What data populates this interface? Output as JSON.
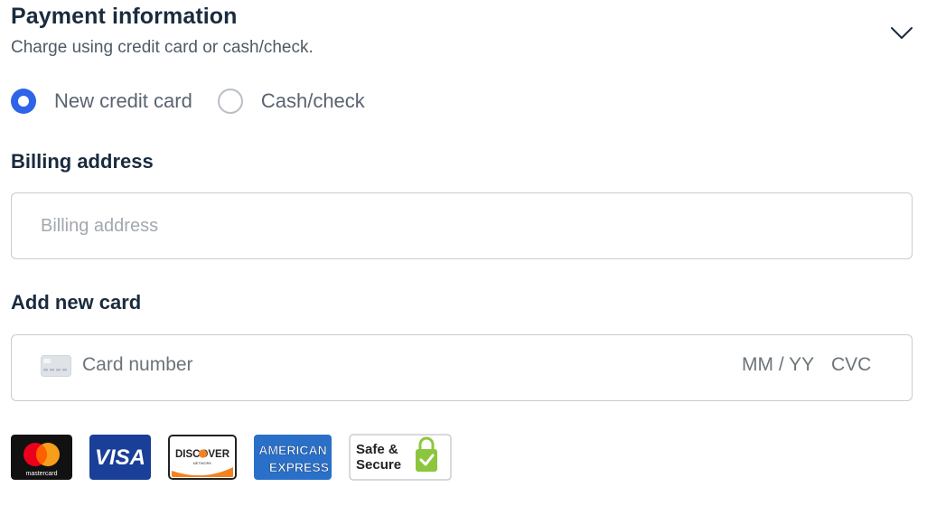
{
  "header": {
    "title": "Payment information",
    "subtitle": "Charge using credit card or cash/check.",
    "collapse_icon": "chevron-down-icon"
  },
  "payment_method": {
    "options": [
      {
        "label": "New credit card",
        "selected": true
      },
      {
        "label": "Cash/check",
        "selected": false
      }
    ]
  },
  "billing": {
    "label": "Billing address",
    "placeholder": "Billing address",
    "value": ""
  },
  "card": {
    "label": "Add new card",
    "number_placeholder": "Card number",
    "expiry_placeholder": "MM / YY",
    "cvc_placeholder": "CVC",
    "icon": "credit-card-icon"
  },
  "logos": {
    "mastercard": "mastercard",
    "visa": "VISA",
    "discover": "DISCOVER",
    "discover_sub": "NETWORK",
    "amex_top": "AMERICAN",
    "amex_bottom": "EXPRESS",
    "secure_top": "Safe &",
    "secure_bottom": "Secure"
  },
  "colors": {
    "accent": "#2f64e8",
    "title": "#1a2b3d",
    "visa_blue": "#1a3f99",
    "amex_blue": "#2a70c8",
    "secure_green": "#8cc63f"
  }
}
